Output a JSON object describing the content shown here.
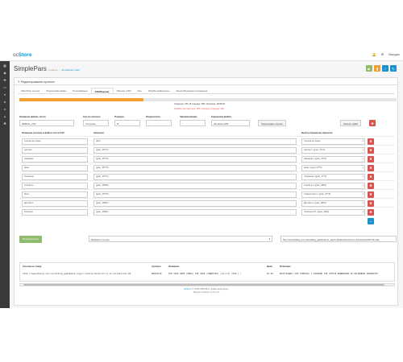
{
  "header": {
    "logo_prefix": "oc",
    "logo_name": "Store",
    "user": "Валдис"
  },
  "sidebar": {
    "icons": [
      "dashboard-icon",
      "tags-icon",
      "puzzle-icon",
      "desktop-icon",
      "cart-icon",
      "user-icon",
      "share-icon",
      "chart-icon",
      "gear-icon"
    ]
  },
  "page": {
    "title": "SimplePars",
    "breadcrumb": [
      "Главная",
      "SimplePars Start"
    ],
    "panel_title": "Редактирование проекта"
  },
  "tabs": [
    {
      "label": "URL/Сбор ссылок"
    },
    {
      "label": "Парсинг/Настройки"
    },
    {
      "label": "Поиск/Замена"
    },
    {
      "label": "CSV/Парсинг",
      "active": true
    },
    {
      "label": "Парсинг в ИМ"
    },
    {
      "label": "Кэш"
    },
    {
      "label": "Обработка/Фильтры"
    },
    {
      "label": "Запись/Проверка Сохранения"
    }
  ],
  "progress": {
    "fraction": 0.33,
    "status": "Спарсено: 151 | В очереди: 305 | Осталось: 00:05:22",
    "error": "Ошибки при парсинге: 155 | Ссылок в очереди: 305"
  },
  "settings": {
    "csv_name_label": "Название файла, листа",
    "csv_name_value": "DEMAIL_CSV",
    "columns_label": "Кол-во колонок",
    "columns_value": "3 колонки",
    "order_label": "Порядок",
    "order_value": "Я",
    "delimiter_label": "Разделитель",
    "delimiter_value": ";",
    "shield_label": "Экранирование",
    "shield_value": "\"",
    "encoding_label": "Кодировка файла",
    "encoding_value": "Windows-1251",
    "recreate_button": "Пересоздать ссылки",
    "download_button": "Скачать файл"
  },
  "mapping": {
    "col1_header": "Название колонки в файле листа CSV",
    "col2_header": "Значение",
    "col3_header": "Выбор параметра парсинга",
    "rows": [
      {
        "name": "Ссылка на товар",
        "value": "{link}",
        "param": "Ссылка на товар"
      },
      {
        "name": "Артикул",
        "value": "{gran_35774}",
        "param": "Артикул | {gran_3774}"
      },
      {
        "name": "Название",
        "value": "{gran_35775}",
        "param": "Название | {gran_3775}"
      },
      {
        "name": "Цена",
        "value": "{gran_35770}",
        "param": "Цена | {gran_3770}"
      },
      {
        "name": "Описание",
        "value": "{gran_35771}",
        "param": "Описание | {gran_3771}"
      },
      {
        "name": "Атрибуты",
        "value": "{gran_35865}",
        "param": "Атрибуты | {gran_3865}"
      },
      {
        "name": "Фото",
        "value": "{gran_35776}",
        "param": "Главное фото | {gran_3776}"
      },
      {
        "name": "Доп.фото",
        "value": "{gran_35861}",
        "param": "Доп.фото | {gran_3861}"
      },
      {
        "name": "Хлебные",
        "value": "{gran_35862}",
        "param": "Хлебные КП | {gran_3862}"
      }
    ]
  },
  "preview": {
    "button": "Предпросмотр",
    "select_placeholder": "Выберите ссылку",
    "url": "http://newcatalog.com.ua/catalog_gadamamie_sigs/n-thalia-tavel-bt-lv-tv-24-tehnical-96-hof-mail",
    "headers": [
      "Ссылка на товар",
      "Артикул",
      "Название",
      "Цена",
      "Описание"
    ],
    "values": [
      "http://newcatalog.com.ua/catalog_gadamamie_sigs/n-thalia-tavel-bt-lv-tv-24-tehnical-96",
      "M0000238",
      "ТНЕ 2000 НОМЕ (НИКО) ТНЕ 2000 (ЭЛДЕКТРО) (v4.2.5) (НОК.) )",
      "46 00",
      "ФОТОГРАФИЯ (ТНЕ СЕВЕРАЛ) С НАЛИЧИЕ ТНЕ СЕНТАЕ-МАШИНАРИЯ ОБ ПОСЛЕДНИЕ ОБРАБОТКЕ"
    ]
  },
  "footer": {
    "link": "ocStore",
    "text": "© 2009-2020 Все права защищены.",
    "version": "Версия ocStore 2.3.0.2.3"
  }
}
